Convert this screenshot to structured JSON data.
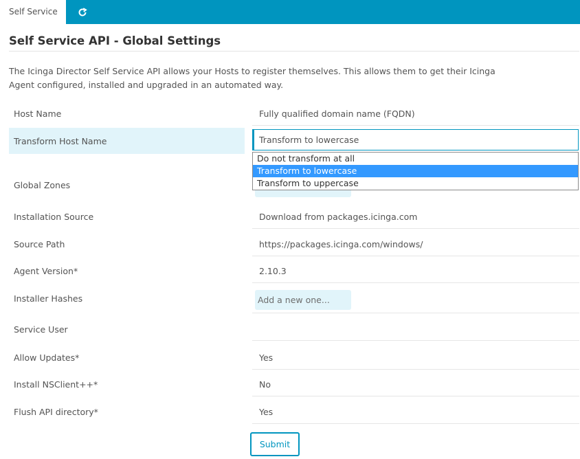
{
  "tabs": {
    "active_label": "Self Service"
  },
  "icons": {
    "refresh": "refresh-icon"
  },
  "page": {
    "title": "Self Service API - Global Settings",
    "intro": "The Icinga Director Self Service API allows your Hosts to register themselves. This allows them to get their Icinga Agent configured, installed and upgraded in an automated way."
  },
  "form": {
    "host_name": {
      "label": "Host Name",
      "value": "Fully qualified domain name (FQDN)"
    },
    "transform_host_name": {
      "label": "Transform Host Name",
      "selected": "Transform to lowercase",
      "options": [
        "Do not transform at all",
        "Transform to lowercase",
        "Transform to uppercase"
      ]
    },
    "global_zones": {
      "label": "Global Zones"
    },
    "installation_source": {
      "label": "Installation Source",
      "value": "Download from packages.icinga.com"
    },
    "source_path": {
      "label": "Source Path",
      "value": "https://packages.icinga.com/windows/"
    },
    "agent_version": {
      "label": "Agent Version*",
      "value": "2.10.3"
    },
    "installer_hashes": {
      "label": "Installer Hashes",
      "placeholder": "Add a new one..."
    },
    "service_user": {
      "label": "Service User",
      "value": ""
    },
    "allow_updates": {
      "label": "Allow Updates*",
      "value": "Yes"
    },
    "install_nsclient": {
      "label": "Install NSClient++*",
      "value": "No"
    },
    "flush_api_directory": {
      "label": "Flush API directory*",
      "value": "Yes"
    },
    "submit_label": "Submit"
  },
  "colors": {
    "accent": "#0095bf",
    "highlight": "#e1f4fa",
    "selected_option": "#3399ff"
  }
}
